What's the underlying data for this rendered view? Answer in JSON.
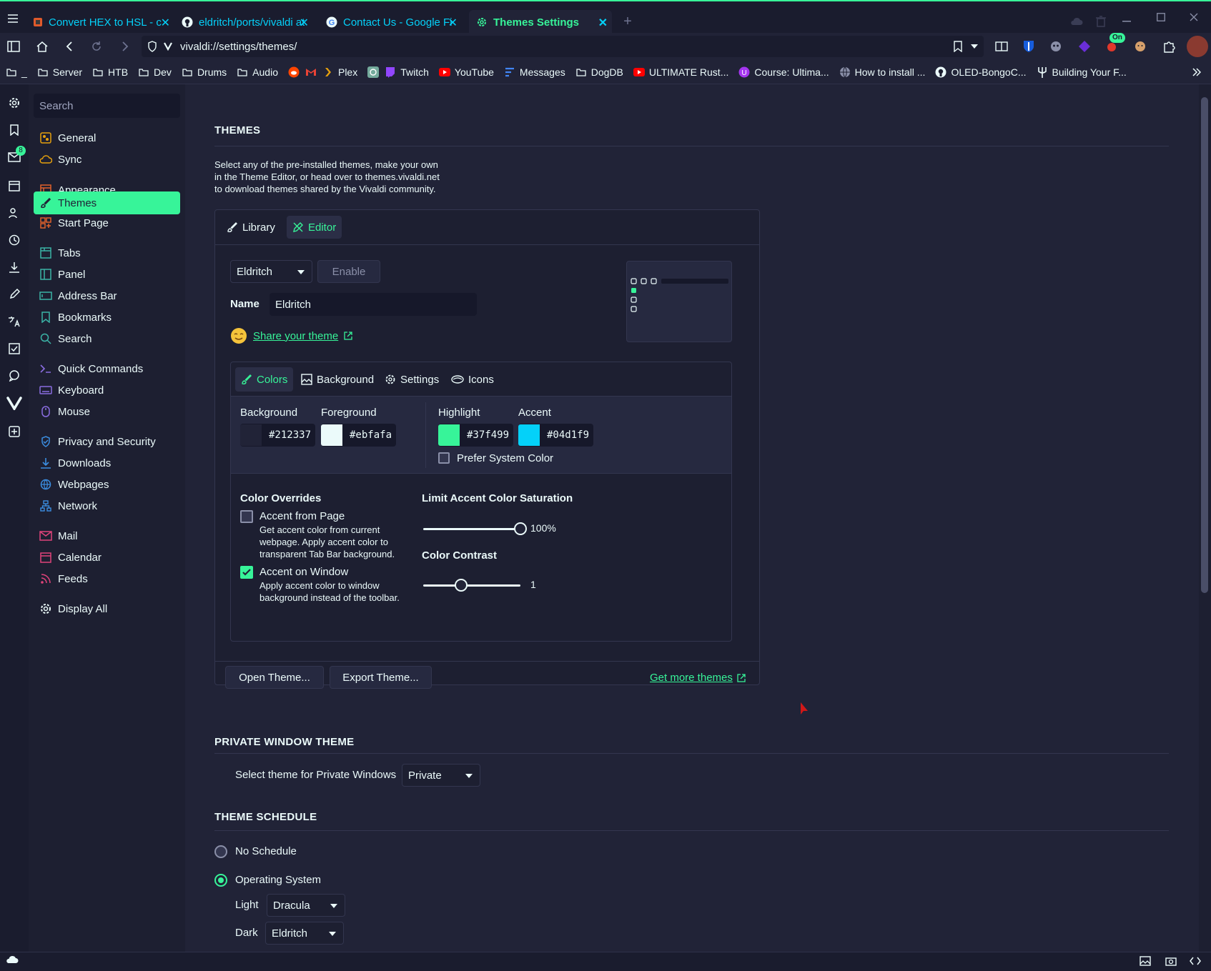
{
  "tabs": [
    {
      "label": "Convert HEX to HSL - c",
      "icon": "hex-converter-icon"
    },
    {
      "label": "eldritch/ports/vivaldi at",
      "icon": "github-icon"
    },
    {
      "label": "Contact Us - Google Fi",
      "icon": "google-icon"
    },
    {
      "label": "Themes Settings",
      "icon": "gear-icon"
    }
  ],
  "address": {
    "url": "vivaldi://settings/themes/"
  },
  "bookmarks": [
    "_",
    "Server",
    "HTB",
    "Dev",
    "Drums",
    "Audio",
    "Plex",
    "Twitch",
    "YouTube",
    "Messages",
    "DogDB",
    "ULTIMATE Rust...",
    "Course: Ultima...",
    "How to install ...",
    "OLED-BongoC...",
    "Building Your F..."
  ],
  "extension_badge": "On",
  "mail_badge": "8",
  "nav": {
    "search_placeholder": "Search",
    "items": [
      "General",
      "Sync",
      "Appearance",
      "Themes",
      "Start Page",
      "Tabs",
      "Panel",
      "Address Bar",
      "Bookmarks",
      "Search",
      "Quick Commands",
      "Keyboard",
      "Mouse",
      "Privacy and Security",
      "Downloads",
      "Webpages",
      "Network",
      "Mail",
      "Calendar",
      "Feeds",
      "Display All"
    ],
    "active": "Themes"
  },
  "themes": {
    "title": "THEMES",
    "description_1": "Select any of the pre-installed themes, make your own",
    "description_2": "in the Theme Editor, or head over to themes.vivaldi.net",
    "description_3": "to download themes shared by the Vivaldi community.",
    "tab_library": "Library",
    "tab_editor": "Editor",
    "theme_select": "Eldritch",
    "enable_button": "Enable",
    "name_label": "Name",
    "name_value": "Eldritch",
    "share_link": "Share your theme",
    "subtabs": [
      "Colors",
      "Background",
      "Settings",
      "Icons"
    ],
    "colors": {
      "background_label": "Background",
      "background_value": "#212337",
      "foreground_label": "Foreground",
      "foreground_value": "#ebfafa",
      "highlight_label": "Highlight",
      "highlight_value": "#37f499",
      "accent_label": "Accent",
      "accent_value": "#04d1f9",
      "prefer_system": "Prefer System Color"
    },
    "overrides": {
      "title": "Color Overrides",
      "accent_from_page": "Accent from Page",
      "accent_from_page_desc_1": "Get accent color from current",
      "accent_from_page_desc_2": "webpage. Apply accent color to",
      "accent_from_page_desc_3": "transparent Tab Bar background.",
      "accent_on_window": "Accent on Window",
      "accent_on_window_desc_1": "Apply accent color to window",
      "accent_on_window_desc_2": "background instead of the toolbar.",
      "accent_from_page_checked": false,
      "accent_on_window_checked": true
    },
    "saturation": {
      "title": "Limit Accent Color Saturation",
      "value": "100%",
      "fraction": 1.0
    },
    "contrast": {
      "title": "Color Contrast",
      "value": "1",
      "fraction": 0.38
    },
    "open_button": "Open Theme...",
    "export_button": "Export Theme...",
    "more_link": "Get more themes"
  },
  "private": {
    "title": "PRIVATE WINDOW THEME",
    "label": "Select theme for Private Windows",
    "value": "Private"
  },
  "schedule": {
    "title": "THEME SCHEDULE",
    "no_schedule": "No Schedule",
    "os": "Operating System",
    "light_label": "Light",
    "light_value": "Dracula",
    "dark_label": "Dark",
    "dark_value": "Eldritch",
    "selected": "Operating System"
  },
  "colors": {
    "bg": "#212337",
    "fg": "#ebfafa",
    "highlight": "#37f499",
    "accent": "#04d1f9"
  }
}
